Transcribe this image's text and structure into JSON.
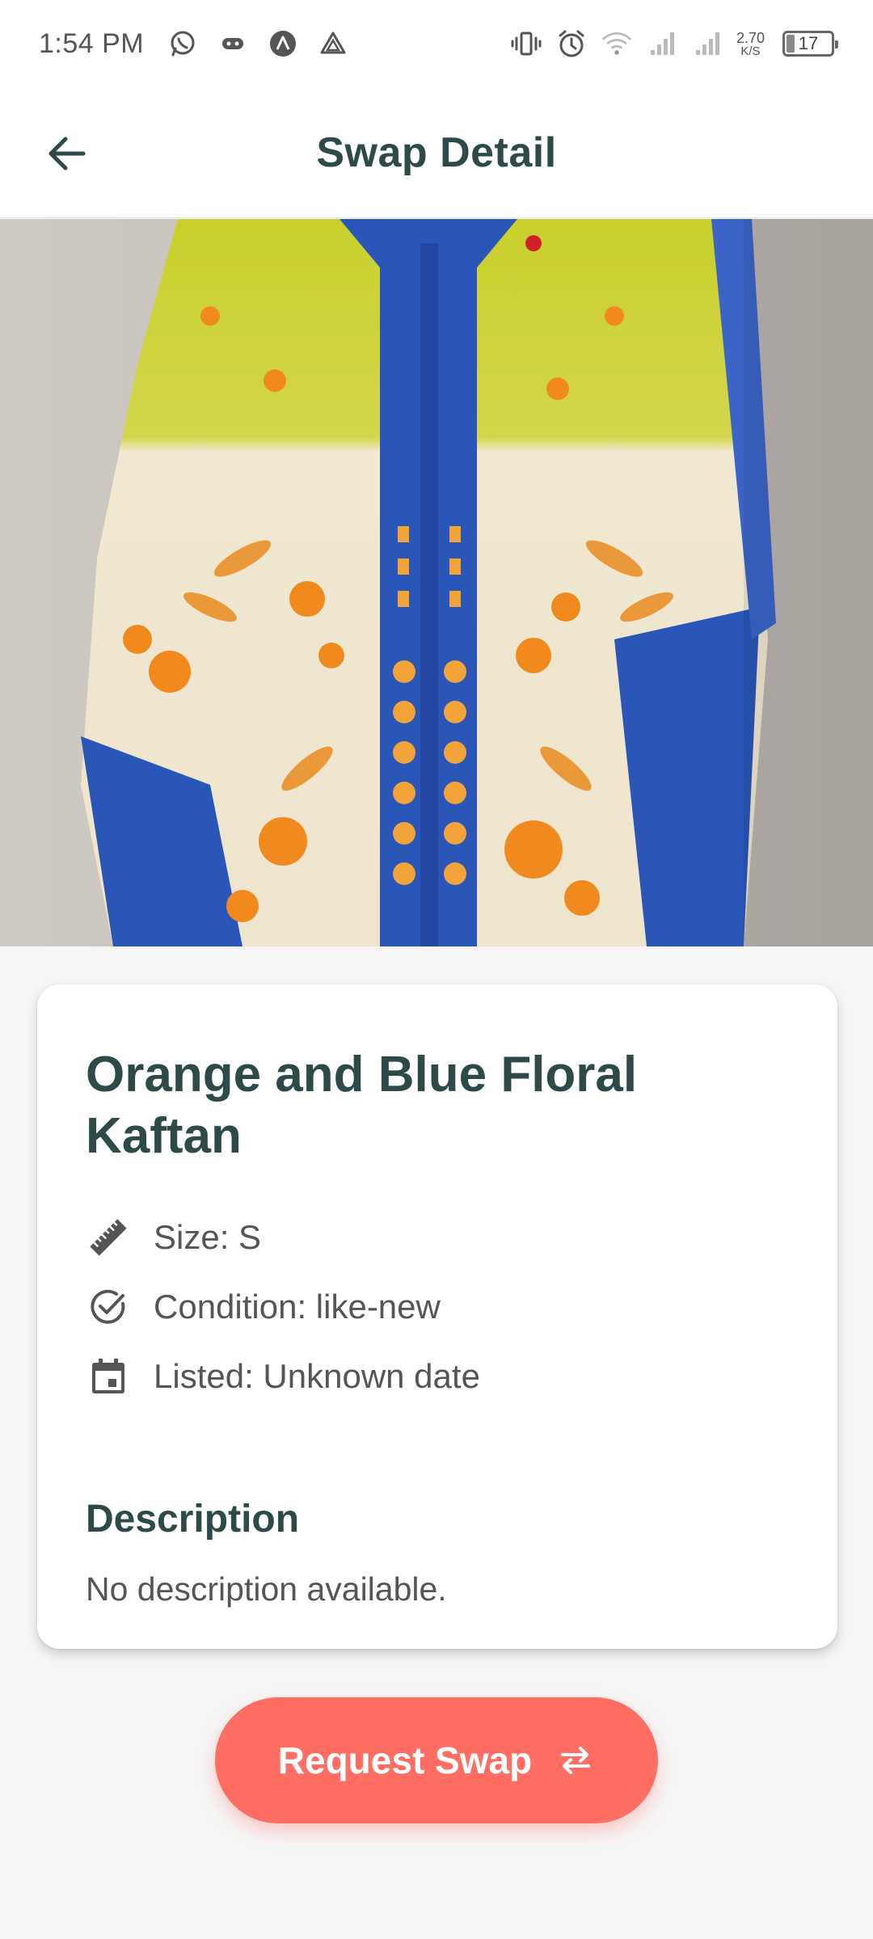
{
  "status_bar": {
    "time": "1:54 PM",
    "speed_value": "2.70",
    "speed_unit": "K/S",
    "battery": "17",
    "icons": [
      "whatsapp-icon",
      "game-controller-icon",
      "notification-a-icon",
      "drive-icon",
      "vibrate-icon",
      "alarm-icon",
      "wifi-icon",
      "signal-icon",
      "signal-icon",
      "battery-icon"
    ]
  },
  "app_bar": {
    "title": "Swap Detail",
    "back_icon": "arrow-back-icon"
  },
  "item": {
    "title": "Orange and Blue Floral Kaftan",
    "size": "Size: S",
    "condition": "Condition: like-new",
    "listed": "Listed: Unknown date",
    "description_heading": "Description",
    "description": "No description available."
  },
  "actions": {
    "request_swap": "Request Swap",
    "request_swap_icon": "swap-arrows-icon"
  },
  "colors": {
    "primary_text": "#2d4a48",
    "accent": "#fe6e63",
    "body_text": "#555555",
    "background": "#f6f6f6"
  }
}
